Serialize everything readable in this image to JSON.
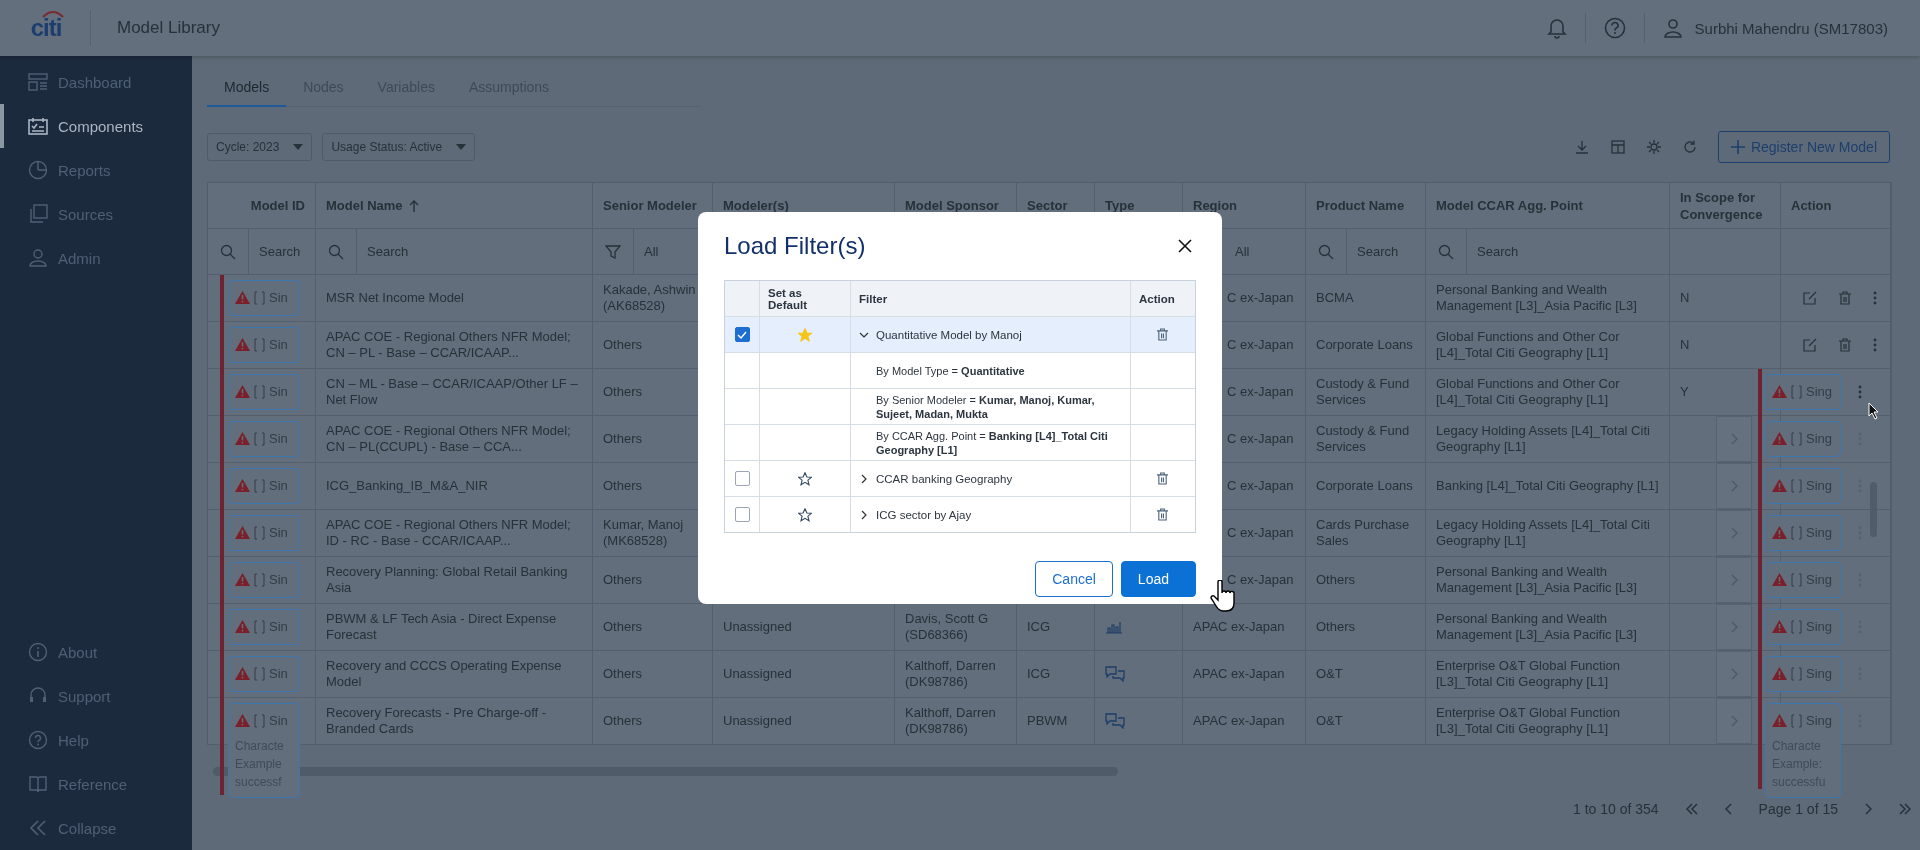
{
  "header": {
    "logo": "citi",
    "title": "Model Library",
    "user": "Surbhi Mahendru (SM17803)"
  },
  "sidebar": {
    "items": [
      {
        "label": "Dashboard",
        "kind": "dashboard",
        "selected": false
      },
      {
        "label": "Components",
        "kind": "components",
        "selected": true
      },
      {
        "label": "Reports",
        "kind": "reports",
        "selected": false
      },
      {
        "label": "Sources",
        "kind": "sources",
        "selected": false
      },
      {
        "label": "Admin",
        "kind": "admin",
        "selected": false
      }
    ],
    "bottom_items": [
      {
        "label": "About",
        "kind": "info"
      },
      {
        "label": "Support",
        "kind": "support"
      },
      {
        "label": "Help",
        "kind": "help"
      },
      {
        "label": "Reference",
        "kind": "reference"
      },
      {
        "label": "Collapse",
        "kind": "collapse"
      }
    ]
  },
  "tabs": [
    {
      "label": "Models",
      "selected": true
    },
    {
      "label": "Nodes",
      "selected": false
    },
    {
      "label": "Variables",
      "selected": false
    },
    {
      "label": "Assumptions",
      "selected": false
    }
  ],
  "toolbar": {
    "dropdowns": [
      "Cycle: 2023",
      "Usage Status: Active"
    ],
    "register_button": "Register New Model"
  },
  "table": {
    "columns": [
      {
        "label": "Model ID",
        "filter": {
          "kind": "search",
          "placeholder": "Search"
        }
      },
      {
        "label": "Model Name",
        "sorted": true,
        "filter": {
          "kind": "search",
          "placeholder": "Search"
        }
      },
      {
        "label": "Senior Modeler",
        "filter": {
          "kind": "select",
          "value": "All"
        }
      },
      {
        "label": "Modeler(s)"
      },
      {
        "label": "Model Sponsor"
      },
      {
        "label": "Sector"
      },
      {
        "label": "Type"
      },
      {
        "label": "Region",
        "filter": {
          "kind": "value",
          "value": "All"
        }
      },
      {
        "label": "Product Name",
        "filter": {
          "kind": "search",
          "placeholder": "Search"
        }
      },
      {
        "label": "Model CCAR Agg. Point",
        "filter": {
          "kind": "search",
          "placeholder": "Search"
        }
      },
      {
        "label": "In Scope for Convergence"
      },
      {
        "label": "Action"
      }
    ],
    "rows": [
      {
        "chip": "Sin",
        "name": "MSR Net Income Model",
        "senior": "Kakade, Ashwin (AK68528)",
        "region": "C ex-Japan",
        "product": "BCMA",
        "ccar": "Personal Banking and Wealth Management [L3]_Asia Pacific [L3]",
        "scope": "N",
        "actions": true
      },
      {
        "chip": "Sin",
        "name": "APAC COE - Regional Others NFR Model; CN – PL - Base – CCAR/ICAAP...",
        "senior": "Others",
        "region": "C ex-Japan",
        "product": "Corporate Loans",
        "ccar": "Global Functions and Other Cor [L4]_Total Citi Geography [L1]",
        "scope": "N",
        "actions": true
      },
      {
        "chip": "Sin",
        "name": "CN – ML - Base – CCAR/ICAAP/Other LF – Net Flow",
        "senior": "Others",
        "region": "C ex-Japan",
        "product": "Custody & Fund Services",
        "ccar": "Global Functions and Other Cor [L4]_Total Citi Geography [L1]",
        "scope": "Y",
        "actions": false
      },
      {
        "chip": "Sin",
        "name": "APAC COE - Regional Others NFR Model; CN – PL(CCUPL) - Base – CCA...",
        "senior": "Others",
        "region": "C ex-Japan",
        "product": "Custody & Fund Services",
        "ccar": "Legacy Holding Assets [L4]_Total Citi Geography [L1]",
        "actions": false
      },
      {
        "chip": "Sin",
        "name": "ICG_Banking_IB_M&A_NIR",
        "senior": "Others",
        "region": "C ex-Japan",
        "product": "Corporate Loans",
        "ccar": "Banking [L4]_Total Citi Geography [L1]",
        "actions": false
      },
      {
        "chip": "Sin",
        "name": "APAC COE - Regional Others NFR Model; ID - RC - Base - CCAR/ICAAP...",
        "senior": "Kumar, Manoj (MK68528)",
        "region": "C ex-Japan",
        "product": "Cards Purchase Sales",
        "ccar": "Legacy Holding Assets [L4]_Total Citi Geography [L1]",
        "actions": false
      },
      {
        "chip": "Sin",
        "name": "Recovery Planning: Global Retail Banking Asia",
        "senior": "Others",
        "region": "C ex-Japan",
        "product": "Others",
        "ccar": "Personal Banking and Wealth Management [L3]_Asia Pacific [L3]",
        "actions": false
      },
      {
        "chip": "Sin",
        "name": "PBWM & LF Tech Asia - Direct Expense Forecast",
        "senior": "Others",
        "modelers": "Unassigned",
        "sponsor": "Davis, Scott G (SD68366)",
        "sector": "ICG",
        "type": {
          "kind": "bars"
        },
        "region": "APAC ex-Japan",
        "product": "Others",
        "ccar": "Personal Banking and Wealth Management [L3]_Asia Pacific [L3]",
        "actions": false
      },
      {
        "chip": "Sin",
        "name": "Recovery and CCCS Operating Expense Model",
        "senior": "Others",
        "modelers": "Unassigned",
        "sponsor": "Kalthoff, Darren (DK98786)",
        "sector": "ICG",
        "type": {
          "kind": "chat"
        },
        "region": "APAC ex-Japan",
        "product": "O&T",
        "ccar": "Enterprise O&T Global Function [L3]_Total Citi Geography [L1]",
        "actions": false
      },
      {
        "chip": "Sin",
        "lines": [
          "Characte",
          "Example",
          "successf"
        ],
        "name": "Recovery Forecasts - Pre Charge-off - Branded Cards",
        "senior": "Others",
        "modelers": "Unassigned",
        "sponsor": "Kalthoff, Darren (DK98786)",
        "sector": "PBWM",
        "type": {
          "kind": "chat"
        },
        "region": "APAC ex-Japan",
        "product": "O&T",
        "ccar": "Enterprise O&T Global Function [L3]_Total Citi Geography [L1]",
        "actions": false
      }
    ]
  },
  "overlay_panel": {
    "rows": [
      {
        "chevron": false,
        "chip": "Sing"
      },
      {
        "chevron": true,
        "chip": "Sing"
      },
      {
        "chevron": true,
        "chip": "Sing"
      },
      {
        "chevron": true,
        "chip": "Sing"
      },
      {
        "chevron": true,
        "chip": "Sing"
      },
      {
        "chevron": true,
        "chip": "Sing"
      },
      {
        "chevron": true,
        "chip": "Sing"
      },
      {
        "chevron": true,
        "chip": "Sing",
        "lines": [
          "Characte",
          "Example:",
          "successfu"
        ]
      }
    ]
  },
  "pagination": {
    "range": "1 to 10 of 354",
    "page": "Page 1 of 15"
  },
  "modal": {
    "title": "Load Filter(s)",
    "columns": [
      "Set as Default",
      "Filter",
      "Action"
    ],
    "filters": [
      {
        "name": "Quantitative Model by Manoj",
        "checked": true,
        "default": true,
        "expanded": true,
        "criteria": [
          "By Model Type = **Quantitative**",
          "By Senior Modeler = **Kumar, Manoj, Kumar, Sujeet, Madan, Mukta**",
          "By CCAR Agg. Point = **Banking [L4]_Total Citi Geography [L1]**"
        ]
      },
      {
        "name": "CCAR banking Geography",
        "checked": false,
        "default": false,
        "expanded": false
      },
      {
        "name": "ICG sector by Ajay",
        "checked": false,
        "default": false,
        "expanded": false
      }
    ],
    "cancel": "Cancel",
    "load": "Load"
  }
}
